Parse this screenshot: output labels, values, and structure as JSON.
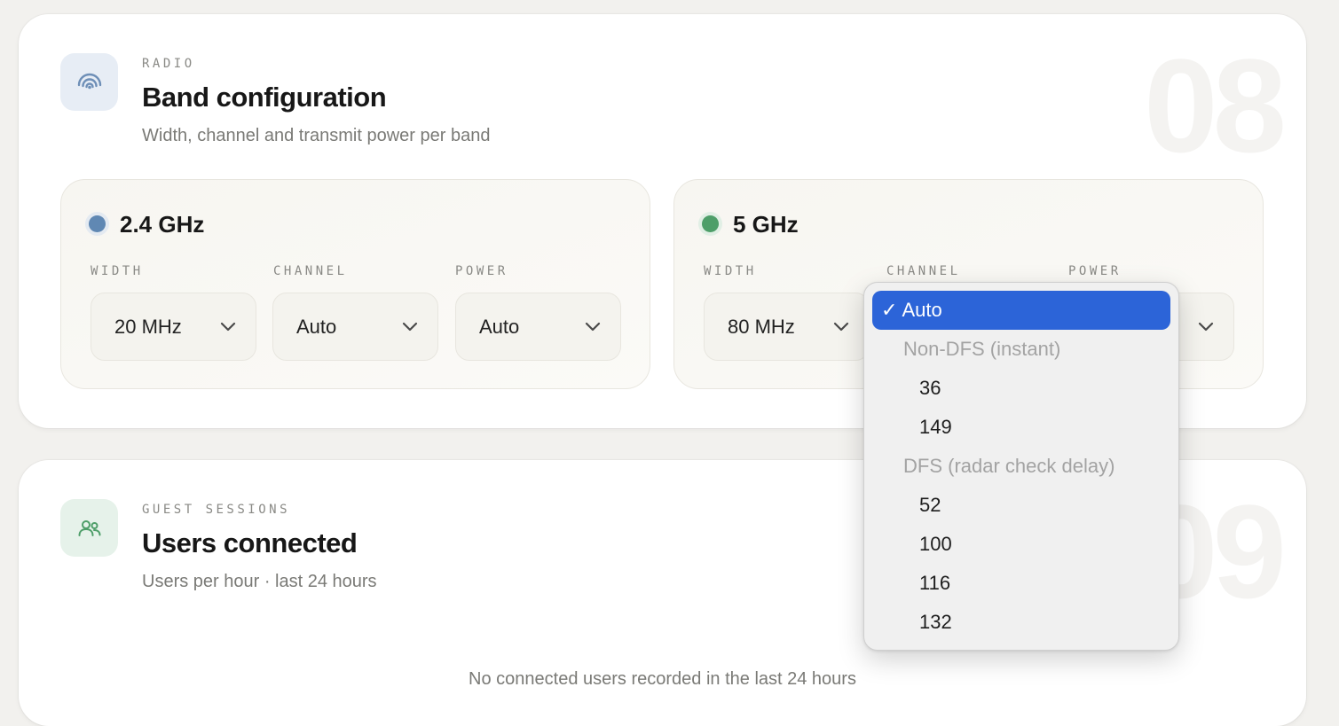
{
  "radio_card": {
    "eyebrow": "RADIO",
    "title": "Band configuration",
    "subtitle": "Width, channel and transmit power per band",
    "number": "08",
    "icon": "wifi-broadcast-icon",
    "bands": [
      {
        "name": "2.4 GHz",
        "dot_color": "#6088b3",
        "width_label": "WIDTH",
        "width_value": "20 MHz",
        "channel_label": "CHANNEL",
        "channel_value": "Auto",
        "power_label": "POWER",
        "power_value": "Auto"
      },
      {
        "name": "5 GHz",
        "dot_color": "#4e9e69",
        "width_label": "WIDTH",
        "width_value": "80 MHz",
        "channel_label": "CHANNEL",
        "power_label": "POWER"
      }
    ]
  },
  "channel_dropdown": {
    "selected": "Auto",
    "check": "✓",
    "group_non_dfs": "Non-DFS (instant)",
    "non_dfs_options": [
      "36",
      "149"
    ],
    "group_dfs": "DFS (radar check delay)",
    "dfs_options": [
      "52",
      "100",
      "116",
      "132"
    ],
    "accent_color": "#2c64d8"
  },
  "guest_card": {
    "eyebrow": "GUEST SESSIONS",
    "title": "Users connected",
    "subtitle": "Users per hour · last 24 hours",
    "number": "09",
    "icon": "users-icon",
    "empty_message": "No connected users recorded in the last 24 hours"
  }
}
